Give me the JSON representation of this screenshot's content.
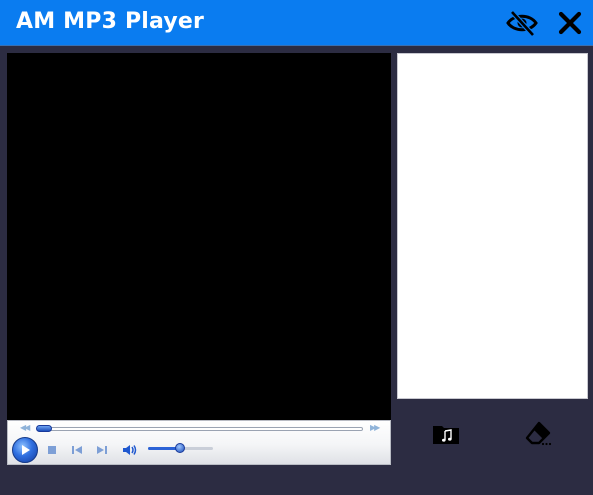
{
  "window": {
    "title": "AM MP3 Player",
    "icons": {
      "hide": "eye-slash-icon",
      "close": "close-icon"
    }
  },
  "player": {
    "seek_progress": 0.02,
    "volume_level": 0.5,
    "icons": [
      "rewind-icon",
      "fast-forward-icon",
      "play-icon",
      "stop-icon",
      "previous-icon",
      "next-icon",
      "volume-icon"
    ]
  },
  "playlist": {
    "items": []
  },
  "actions": {
    "icons": [
      "music-folder-icon",
      "eraser-icon"
    ]
  },
  "colors": {
    "titlebar": "#0a7cf0",
    "background": "#2c2c42",
    "accent": "#2b62d6"
  }
}
